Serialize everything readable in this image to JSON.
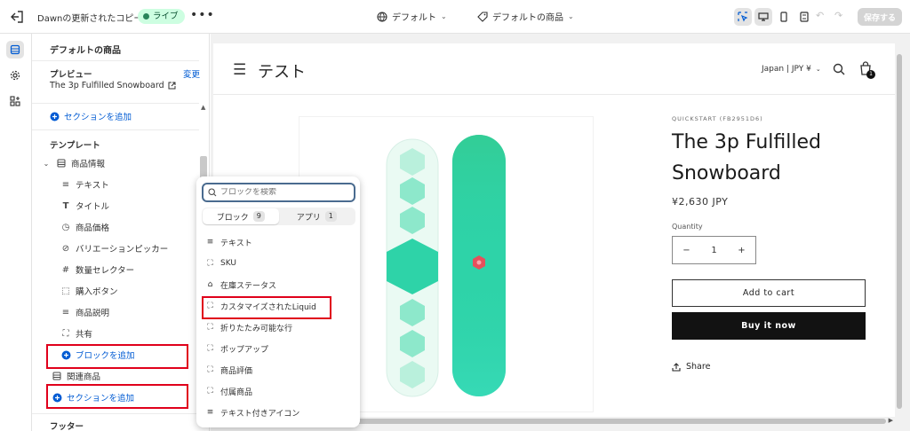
{
  "topbar": {
    "theme_name": "Dawnの更新されたコピー",
    "live_label": "ライブ",
    "more_label": "•••",
    "template_selector": "デフォルト",
    "product_selector": "デフォルトの商品",
    "undo_icon": "↶",
    "redo_icon": "↷",
    "save_label": "保存する"
  },
  "sidebar": {
    "title": "デフォルトの商品",
    "preview_label": "プレビュー",
    "change_label": "変更",
    "preview_product": "The 3p Fulfilled Snowboard",
    "add_section_label": "セクションを追加",
    "template_label": "テンプレート",
    "product_info_label": "商品情報",
    "blocks": [
      {
        "label": "テキスト",
        "icon": "≡"
      },
      {
        "label": "タイトル",
        "icon": "T"
      },
      {
        "label": "商品価格",
        "icon": "◷"
      },
      {
        "label": "バリエーションピッカー",
        "icon": "⊘"
      },
      {
        "label": "数量セレクター",
        "icon": "#"
      },
      {
        "label": "購入ボタン",
        "icon": "⬚"
      },
      {
        "label": "商品説明",
        "icon": "≡"
      },
      {
        "label": "共有",
        "icon": "⛶"
      }
    ],
    "add_block_label": "ブロックを追加",
    "related_label": "関連商品",
    "add_section_label_2": "セクションを追加",
    "footer_label": "フッター"
  },
  "popover": {
    "search_placeholder": "ブロックを検索",
    "tabs": [
      {
        "label": "ブロック",
        "count": "9"
      },
      {
        "label": "アプリ",
        "count": "1"
      }
    ],
    "items": [
      {
        "label": "テキスト",
        "icon": "≡"
      },
      {
        "label": "SKU",
        "icon": "⛶"
      },
      {
        "label": "在庫ステータス",
        "icon": "⌂"
      },
      {
        "label": "カスタマイズされたLiquid",
        "icon": "⛶"
      },
      {
        "label": "折りたたみ可能な行",
        "icon": "⛶"
      },
      {
        "label": "ポップアップ",
        "icon": "⛶"
      },
      {
        "label": "商品評価",
        "icon": "⛶"
      },
      {
        "label": "付属商品",
        "icon": "⛶"
      },
      {
        "label": "テキスト付きアイコン",
        "icon": "≡"
      }
    ]
  },
  "store": {
    "brand": "テスト",
    "locale": "Japan | JPY ¥",
    "cart_count": "1",
    "vendor": "QUICKSTART (FB2951D6)",
    "product_title": "The 3p Fulfilled Snowboard",
    "price": "¥2,630 JPY",
    "quantity_label": "Quantity",
    "quantity_value": "1",
    "minus": "−",
    "plus": "+",
    "add_to_cart": "Add to cart",
    "buy_now": "Buy it now",
    "share": "Share"
  },
  "colors": {
    "accent_blue": "#005bd3",
    "highlight_red": "#e0001b",
    "live_green": "#29845a",
    "board_teal": "#2ed3a8"
  }
}
